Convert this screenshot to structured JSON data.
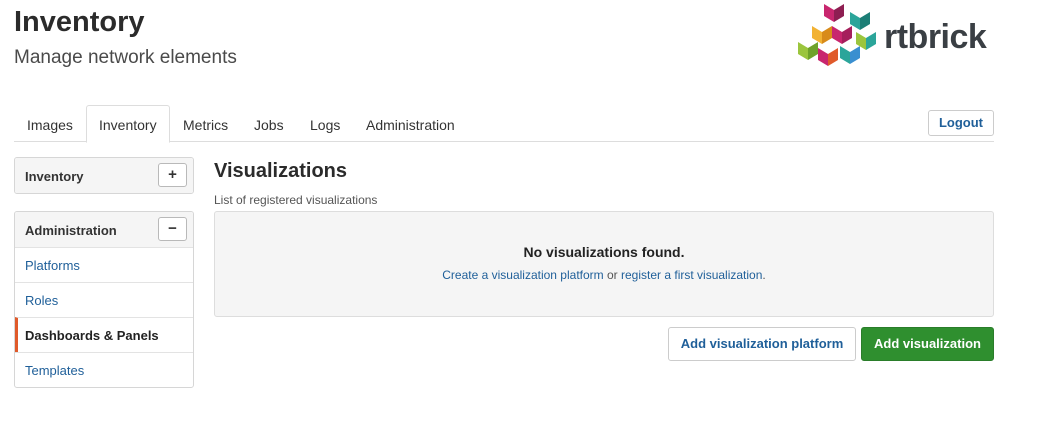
{
  "header": {
    "title": "Inventory",
    "subtitle": "Manage network elements",
    "logo_text": "rtbrick"
  },
  "tabs": [
    {
      "label": "Images",
      "active": false
    },
    {
      "label": "Inventory",
      "active": true
    },
    {
      "label": "Metrics",
      "active": false
    },
    {
      "label": "Jobs",
      "active": false
    },
    {
      "label": "Logs",
      "active": false
    },
    {
      "label": "Administration",
      "active": false
    }
  ],
  "logout_label": "Logout",
  "sidebar": {
    "inventory_panel": {
      "title": "Inventory",
      "toggle": "+"
    },
    "admin_panel": {
      "title": "Administration",
      "toggle": "−",
      "items": [
        {
          "label": "Platforms"
        },
        {
          "label": "Roles"
        },
        {
          "label": "Dashboards & Panels",
          "active": true
        },
        {
          "label": "Templates"
        }
      ]
    }
  },
  "main": {
    "title": "Visualizations",
    "description": "List of registered visualizations",
    "empty": {
      "title": "No visualizations found.",
      "link_create": "Create a visualization platform",
      "connector": " or ",
      "link_register": "register a first visualization",
      "end": "."
    },
    "buttons": {
      "add_platform": "Add visualization platform",
      "add_visualization": "Add visualization"
    }
  },
  "colors": {
    "link": "#1f5f99",
    "primary_button": "#2f8f2f",
    "active_marker": "#e05a2b"
  }
}
